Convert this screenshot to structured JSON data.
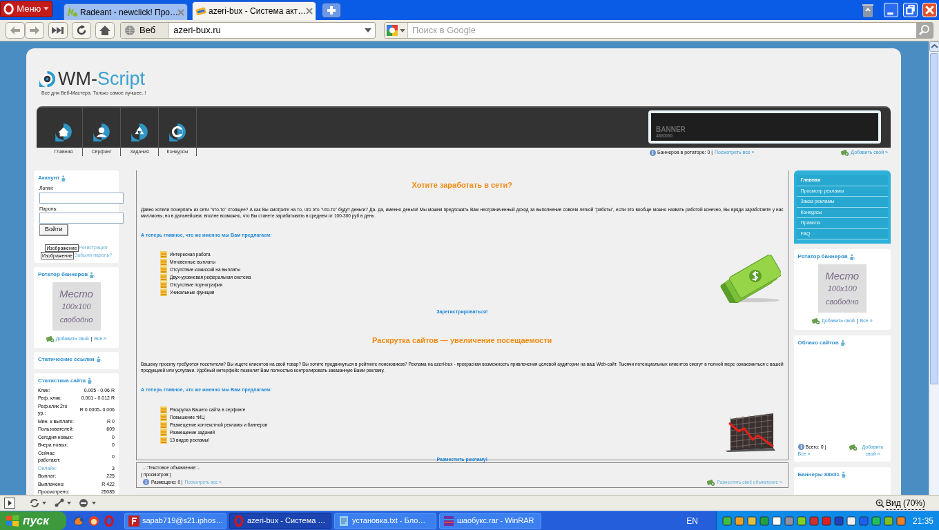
{
  "browser": {
    "menu": "Меню",
    "tabs": [
      {
        "title": "Radeant - newclick! Про…",
        "selected": false
      },
      {
        "title": "azeri-bux - Система акт…",
        "selected": true
      }
    ],
    "scope": "Веб",
    "address": "azeri-bux.ru",
    "search_placeholder": "Поиск в Google"
  },
  "header": {
    "logo_a": "WM-",
    "logo_b": "Script",
    "tagline": "Все для Веб-Мастера. Только самое лучшее..!",
    "nav": [
      "Главная",
      "Сёрфинг",
      "Задания",
      "Конкурсы"
    ],
    "banner": {
      "title": "BANNER",
      "size": "468X60",
      "info": "Баннеров в ротаторе: 0 |",
      "view_all": "Посмотреть все »",
      "add": "Добавить свой »"
    }
  },
  "left": {
    "account": {
      "title": "Аккаунт",
      "login_label": "Логин:",
      "password_label": "Пароль:",
      "button": "Войти",
      "links": [
        {
          "image_alt": "Изображение",
          "label": "Регистрация"
        },
        {
          "image_alt": "Изображение",
          "label": "Забыли пароль?"
        }
      ]
    },
    "rotator": {
      "title": "Ротатор баннеров",
      "place": [
        "Место",
        "100x100",
        "свободно"
      ],
      "add": "Добавить свой",
      "sep": "|",
      "all": "Все »"
    },
    "static_links": {
      "title": "Статические ссылки"
    },
    "stats": {
      "title": "Статистика сайта",
      "rows": [
        {
          "label": "Клик:",
          "value": "0.005 - 0.06 R",
          "kind": "text"
        },
        {
          "label": "Реф. клик:",
          "value": "0.001 - 0.012 R",
          "kind": "text"
        },
        {
          "label": "Реф.клик 2го ур.:",
          "value": "R 0.0005- 0.006",
          "kind": "text"
        },
        {
          "label": "Мин. к выплате:",
          "value": "R 0",
          "kind": "text"
        },
        {
          "label": "Пользователей:",
          "value": "609",
          "kind": "text"
        },
        {
          "label": "Сегодня новых:",
          "value": "0",
          "kind": "text"
        },
        {
          "label": "Вчера новых:",
          "value": "0",
          "kind": "text"
        },
        {
          "label": "Сейчас работают:",
          "value": "0",
          "kind": "text"
        },
        {
          "label": "Онлайн:",
          "value": "3",
          "kind": "link"
        },
        {
          "label": "Выплат:",
          "value": "225",
          "kind": "text"
        },
        {
          "label": "Выплачено:",
          "value": "R 422",
          "kind": "text"
        },
        {
          "label": "Просмотрено:",
          "value": "25085",
          "kind": "text"
        }
      ]
    }
  },
  "center": {
    "sections": [
      {
        "heading": "Хотите заработать в сети?",
        "paragraph": "Давно хотели почерпать из сети \"что-то\" стоящее? А как Вы смотрите на то, что это \"что-то\" будут деньги? Да- да, именно деньги! Мы можем предложить Вам неограниченный доход за выполнение совсем легкой \"работы\", если это вообще можно назвать работой конечно, Вы вряди заработаете у нас миллионы, но в дальнейшем, вполне возможно, что Вы станете зарабатывать в среднем от 100-300 руб в день .",
        "subheading": "А теперь главное, что же именно мы Вам предлагаем:",
        "features": [
          "Интересная работа",
          "Мгновенные выплаты",
          "Отсутствие комиссий на выплаты",
          "Двух-уровневая реферальная система",
          "Отсутствие порнографии",
          "Уникальные функции"
        ],
        "cta": "Зарегистрироваться!",
        "kind": "money"
      },
      {
        "heading": "Раскрутка сайтов — увеличение посещаемости",
        "paragraph": "Вашему проекту требуются посетители? Вы ищете клиентов на свой товар? Вы хотите продвинуться в рейтинге поисковиков? Реклама на azeri-bux - прекрасная возможность привлечения целевой аудитории на ваш Web-сайт. Тысячи потенциальных клиентов смогут в полной мере ознакомиться с вашей продукцией или услугами. Удобный интерфейс позволит Вам полностью контролировать заказанную Вами рекламу.",
        "subheading": "А теперь главное, что же именно мы Вам предлагаем:",
        "features": [
          "Раскрутка Вашего сайта в серфинге",
          "Повышение тИЦ",
          "Размещение контекстной рекламы и баннеров",
          "Размещение заданий",
          "13 видов рекламы!"
        ],
        "cta": "Разместить рекламу!",
        "kind": "chart"
      }
    ],
    "text_ad": {
      "title": "..::Текстовое объявление::..",
      "views": "( просмотров:)",
      "placed": "Размещено: 0 |",
      "view_all": "Посмотреть все »",
      "place": "Разместить своё объявление »"
    }
  },
  "right": {
    "menu": [
      {
        "label": "Главная",
        "selected": true
      },
      {
        "label": "Просмотр рекламы",
        "selected": false
      },
      {
        "label": "Заказ рекламы",
        "selected": false
      },
      {
        "label": "Конкурсы",
        "selected": false
      },
      {
        "label": "Правила",
        "selected": false
      },
      {
        "label": "FAQ",
        "selected": false
      }
    ],
    "rotator": {
      "title": "Ротатор баннеров",
      "place": [
        "Место",
        "100x100",
        "свободно"
      ],
      "add": "Добавить свой",
      "sep": "|",
      "all": "Все »"
    },
    "cloud": {
      "title": "Облако сайтов",
      "total": "Всего: 0 |",
      "all": "Все »",
      "add": "Добавить свой »"
    },
    "banners88": {
      "title": "Баннеры 88x31"
    }
  },
  "status_bar": {
    "zoom": "Вид (70%)"
  },
  "taskbar": {
    "start": "пуск",
    "tasks": [
      {
        "label": "sapab719@s21.iphos…",
        "selected": false
      },
      {
        "label": "azeri-bux - Система …",
        "selected": true
      },
      {
        "label": "установка.txt - Бло…",
        "selected": false
      },
      {
        "label": "шаобукс.rar - WinRAR",
        "selected": false
      }
    ],
    "lang": "EN",
    "clock": "21:35"
  }
}
